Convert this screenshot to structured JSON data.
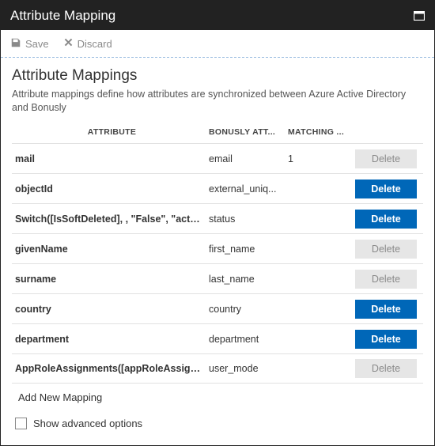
{
  "titlebar": {
    "title": "Attribute Mapping"
  },
  "toolbar": {
    "save": "Save",
    "discard": "Discard"
  },
  "section": {
    "title": "Attribute Mappings",
    "desc": "Attribute mappings define how attributes are synchronized between Azure Active Directory and Bonusly"
  },
  "headers": {
    "attribute": "ATTRIBUTE",
    "bonusly": "BONUSLY ATT...",
    "matching": "MATCHING ..."
  },
  "rows": [
    {
      "attribute": "mail",
      "bonusly": "email",
      "matching": "1",
      "del": "Delete",
      "active": false
    },
    {
      "attribute": "objectId",
      "bonusly": "external_uniq...",
      "matching": "",
      "del": "Delete",
      "active": true
    },
    {
      "attribute": "Switch([IsSoftDeleted], , \"False\", \"active\", \"True",
      "bonusly": "status",
      "matching": "",
      "del": "Delete",
      "active": true
    },
    {
      "attribute": "givenName",
      "bonusly": "first_name",
      "matching": "",
      "del": "Delete",
      "active": false
    },
    {
      "attribute": "surname",
      "bonusly": "last_name",
      "matching": "",
      "del": "Delete",
      "active": false
    },
    {
      "attribute": "country",
      "bonusly": "country",
      "matching": "",
      "del": "Delete",
      "active": true
    },
    {
      "attribute": "department",
      "bonusly": "department",
      "matching": "",
      "del": "Delete",
      "active": true
    },
    {
      "attribute": "AppRoleAssignments([appRoleAssignments])",
      "bonusly": "user_mode",
      "matching": "",
      "del": "Delete",
      "active": false
    }
  ],
  "add_label": "Add New Mapping",
  "advanced_label": "Show advanced options"
}
